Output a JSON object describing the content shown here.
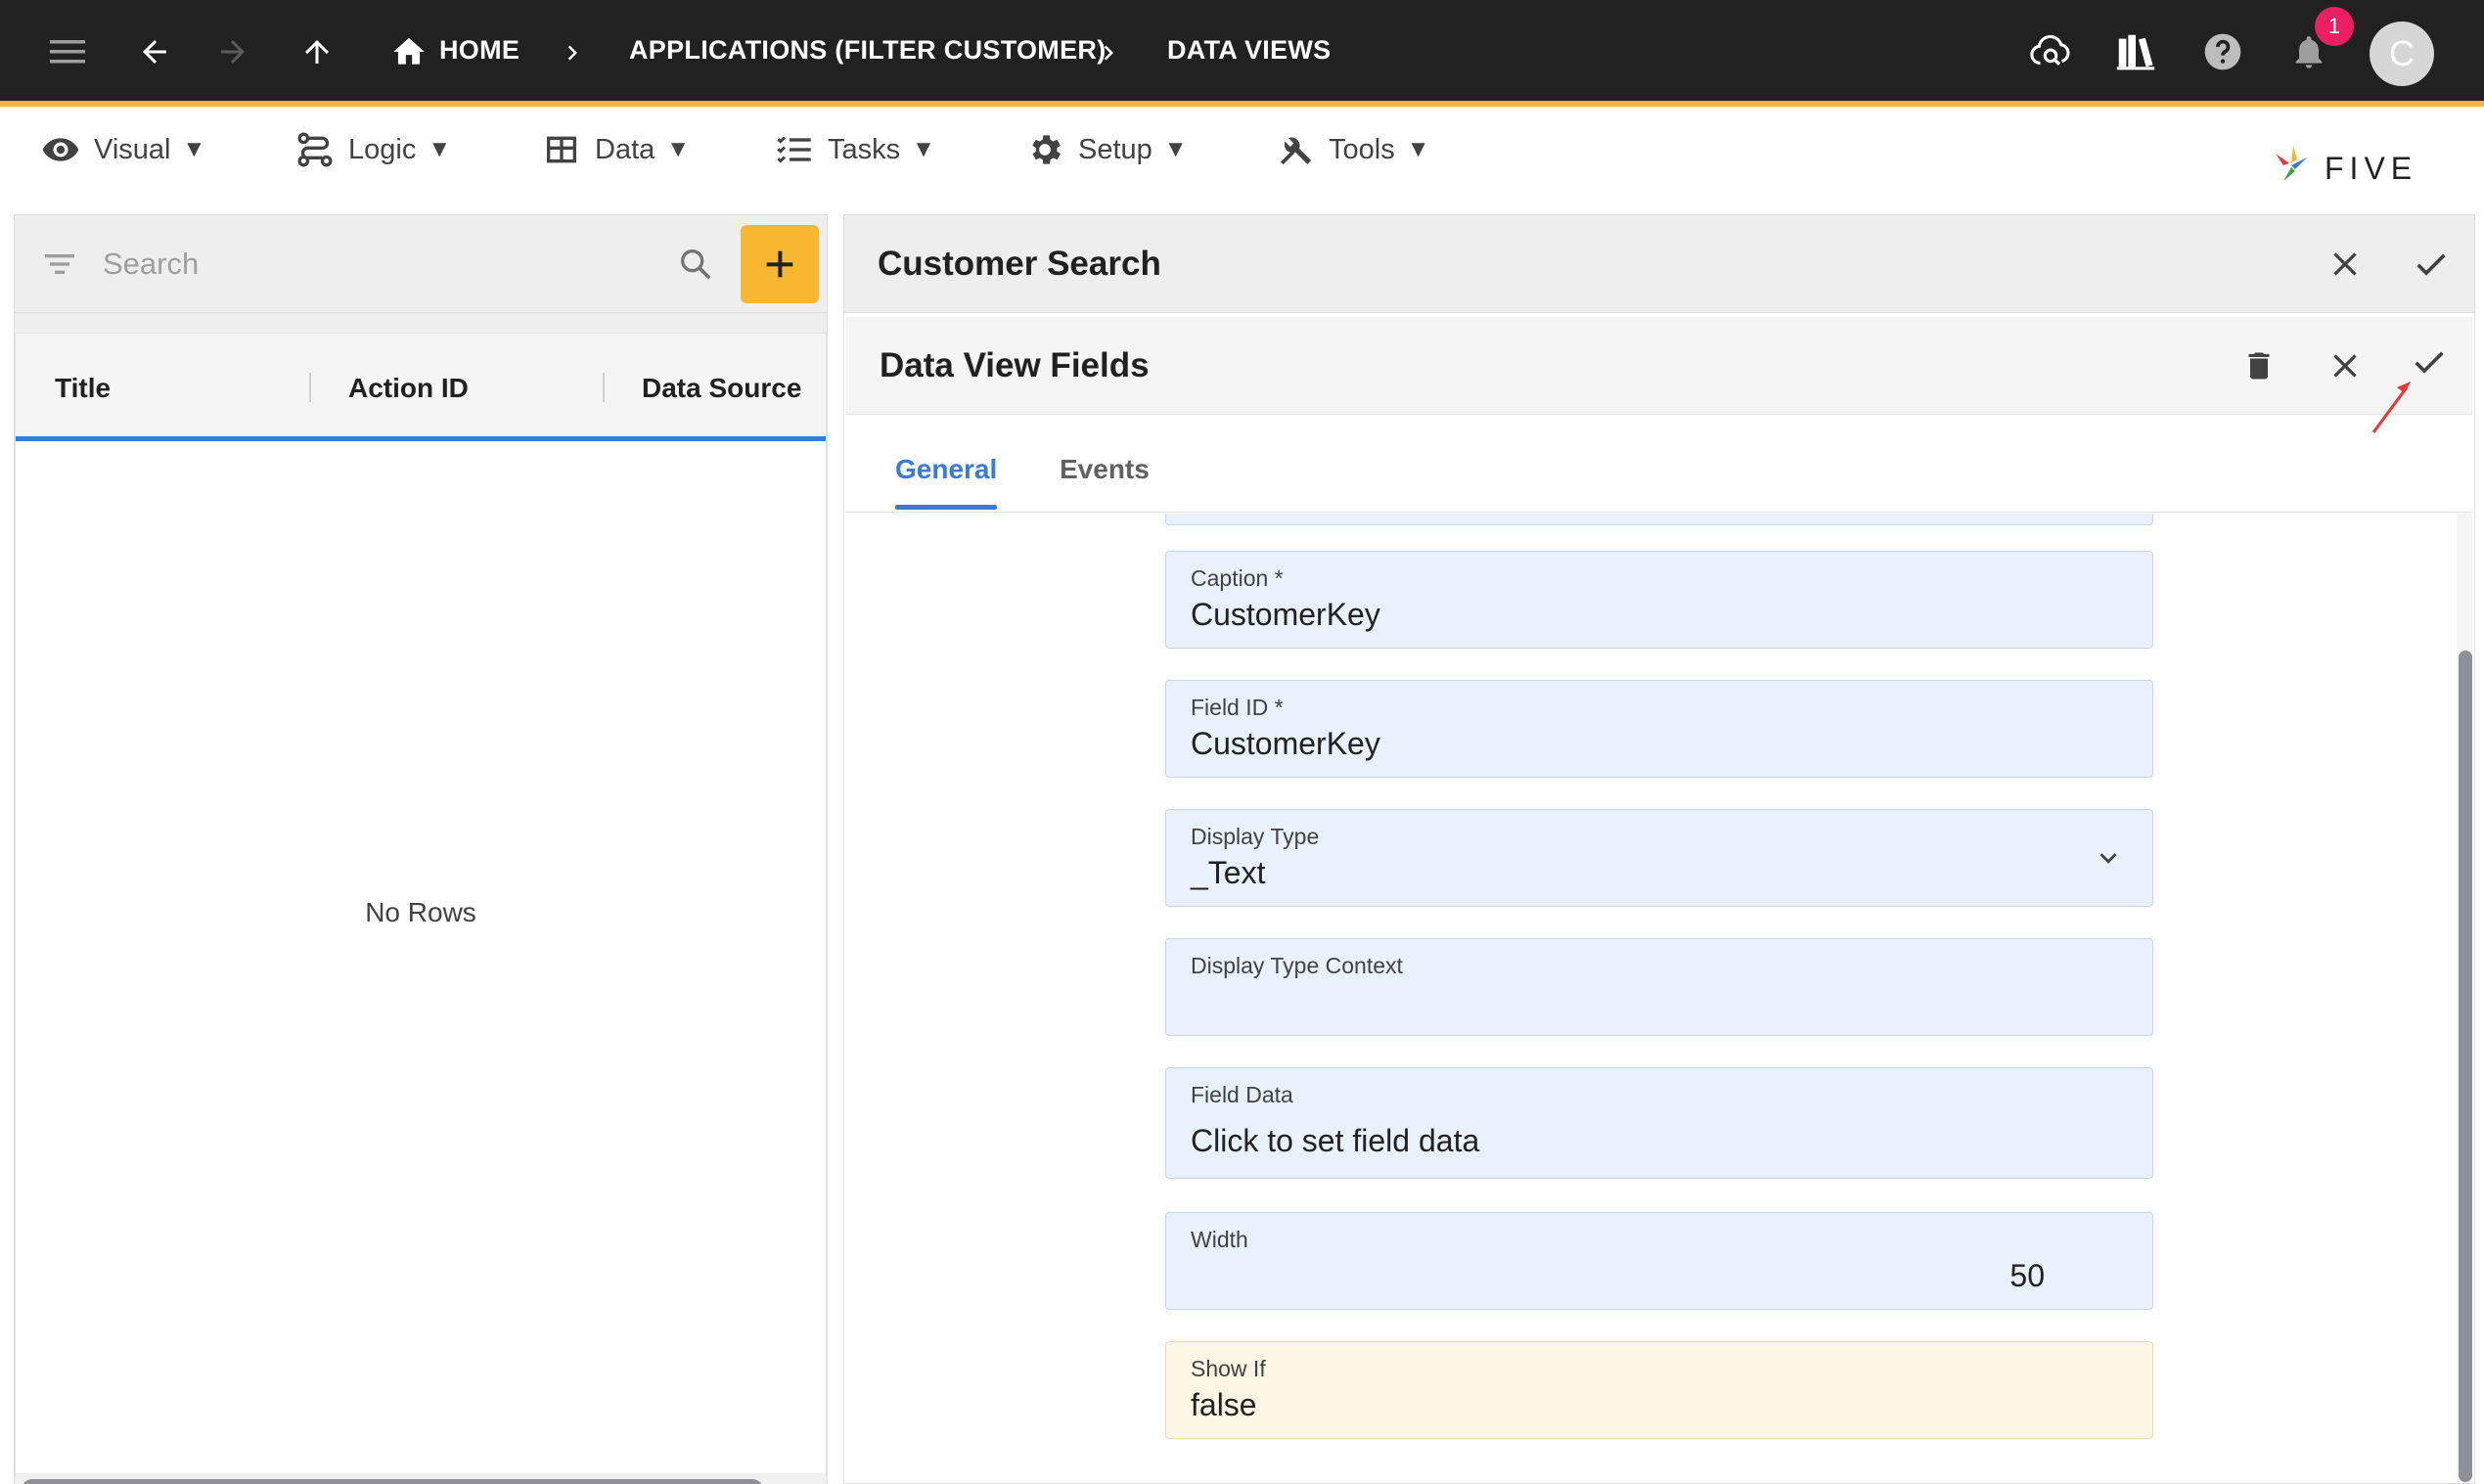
{
  "topbar": {
    "home_label": "HOME",
    "breadcrumb": [
      "APPLICATIONS (FILTER CUSTOMER)",
      "DATA VIEWS"
    ],
    "notification_count": "1",
    "avatar_initial": "C",
    "icons": [
      "menu-icon",
      "back-arrow-icon",
      "forward-arrow-icon",
      "up-arrow-icon",
      "home-icon",
      "cloud-search-icon",
      "library-icon",
      "help-icon",
      "bell-icon"
    ]
  },
  "menubar": {
    "items": [
      {
        "label": "Visual",
        "icon": "eye-icon"
      },
      {
        "label": "Logic",
        "icon": "logic-flow-icon"
      },
      {
        "label": "Data",
        "icon": "table-grid-icon"
      },
      {
        "label": "Tasks",
        "icon": "checklist-icon"
      },
      {
        "label": "Setup",
        "icon": "gear-icon"
      },
      {
        "label": "Tools",
        "icon": "tools-icon"
      }
    ],
    "caret": "▼",
    "logo_text": "FIVE"
  },
  "left_panel": {
    "search_placeholder": "Search",
    "columns": [
      "Title",
      "Action ID",
      "Data Source"
    ],
    "empty_text": "No Rows"
  },
  "right_panel": {
    "title": "Customer Search",
    "subform_title": "Data View Fields",
    "tabs": [
      "General",
      "Events"
    ],
    "active_tab": "General",
    "fields": [
      {
        "label": "Caption *",
        "value": "CustomerKey"
      },
      {
        "label": "Field ID *",
        "value": "CustomerKey"
      },
      {
        "label": "Display Type",
        "value": "_Text"
      },
      {
        "label": "Display Type Context",
        "value": ""
      },
      {
        "label": "Field Data",
        "value": "Click to set field data"
      },
      {
        "label": "Width",
        "value": "50"
      },
      {
        "label": "Show If",
        "value": "false"
      }
    ]
  },
  "colors": {
    "topbar": "#212121",
    "accent": "#f7b731",
    "primary": "#3a7bd5",
    "field_bg": "#e8f1fc",
    "show_if_bg": "#fef6e4",
    "badge": "#e91e63",
    "annotation_arrow": "#e53935"
  }
}
